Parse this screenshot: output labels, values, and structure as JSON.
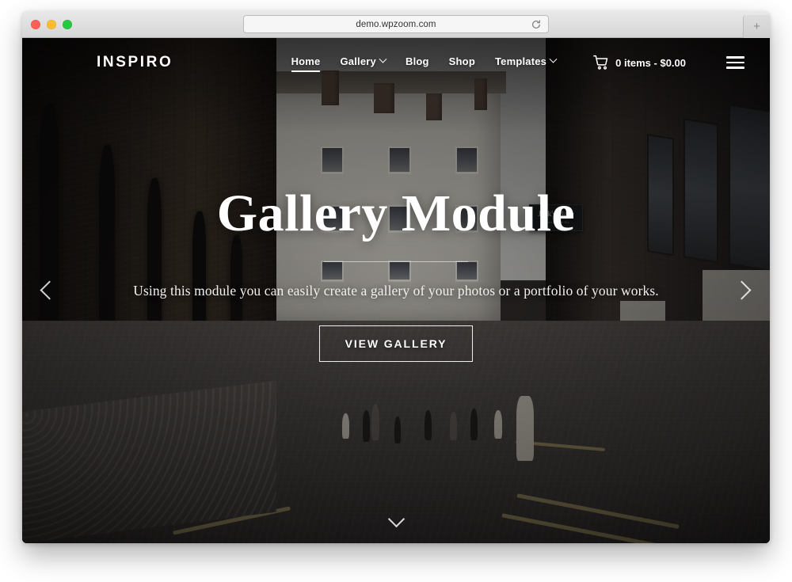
{
  "browser": {
    "url": "demo.wpzoom.com",
    "reload_icon": "reload-icon",
    "new_tab_label": "+",
    "traffic_lights": [
      "close",
      "minimize",
      "zoom"
    ]
  },
  "site": {
    "logo": "INSPIRO",
    "nav": [
      {
        "label": "Home",
        "active": true,
        "has_dropdown": false
      },
      {
        "label": "Gallery",
        "active": false,
        "has_dropdown": true
      },
      {
        "label": "Blog",
        "active": false,
        "has_dropdown": false
      },
      {
        "label": "Shop",
        "active": false,
        "has_dropdown": false
      },
      {
        "label": "Templates",
        "active": false,
        "has_dropdown": true
      }
    ],
    "cart": {
      "icon": "shopping-cart-icon",
      "label": "0 items - $0.00",
      "count": "0",
      "total": "$0.00"
    },
    "menu_toggle_icon": "hamburger-menu-icon"
  },
  "hero": {
    "title": "Gallery Module",
    "subtitle": "Using this module you can easily create a gallery of your photos or a portfolio of your works.",
    "button_label": "VIEW GALLERY",
    "prev_icon": "chevron-left-icon",
    "next_icon": "chevron-right-icon",
    "scroll_icon": "chevron-down-icon"
  },
  "scene": {
    "shop_sign": {
      "name": "Jack's Place",
      "subtitle": "Refreshments Etc"
    }
  },
  "colors": {
    "overlay": "#1a1816",
    "text_light": "#ffffff",
    "chrome_bg": "#e0e0e0",
    "url_bg": "#f6f6f6",
    "traffic_red": "#ff5f57",
    "traffic_yellow": "#febc2e",
    "traffic_green": "#28c840"
  }
}
